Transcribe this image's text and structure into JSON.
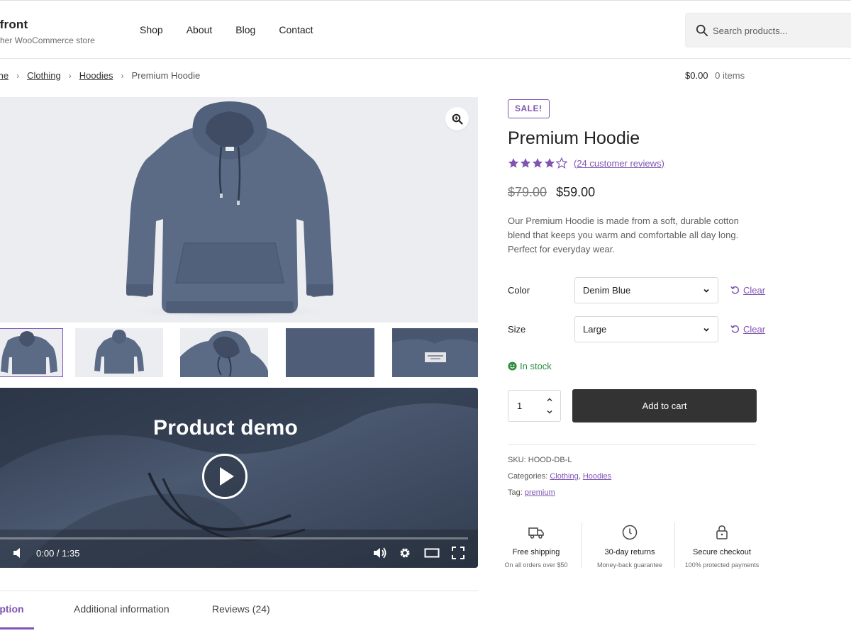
{
  "header": {
    "brand_title": "efront",
    "brand_tagline": "other WooCommerce store",
    "nav": [
      "Shop",
      "About",
      "Blog",
      "Contact"
    ],
    "search_placeholder": "Search products..."
  },
  "breadcrumb": {
    "items": [
      "me",
      "Clothing",
      "Hoodies"
    ],
    "current": "Premium Hoodie"
  },
  "cart": {
    "total": "$0.00",
    "count": "0 items"
  },
  "video": {
    "title": "Product demo",
    "time": "0:00 / 1:35",
    "progress": 0
  },
  "tabs": [
    "ription",
    "Additional information",
    "Reviews (24)"
  ],
  "product": {
    "badge": "SALE!",
    "title": "Premium Hoodie",
    "rating": 4,
    "rating_max": 5,
    "reviews_link": "(24 customer reviews)",
    "price_old": "$79.00",
    "price_new": "$59.00",
    "description": "Our Premium Hoodie is made from a soft, durable cotton blend that keeps you warm and comfortable all day long. Perfect for everyday wear.",
    "color_label": "Color",
    "color_value": "Denim Blue",
    "size_label": "Size",
    "size_value": "Large",
    "clear_label": "Clear",
    "stock": "In stock",
    "quantity": "1",
    "add_to_cart": "Add to cart",
    "sku_label": "SKU:",
    "sku": "HOOD-DB-L",
    "categories_label": "Categories:",
    "categories": [
      "Clothing",
      "Hoodies"
    ],
    "tag_label": "Tag:",
    "tag": "premium"
  },
  "features": [
    {
      "icon": "truck-icon",
      "title": "Free shipping",
      "subtitle": "On all orders over $50"
    },
    {
      "icon": "clock-icon",
      "title": "30-day returns",
      "subtitle": "Money-back guarantee"
    },
    {
      "icon": "lock-icon",
      "title": "Secure checkout",
      "subtitle": "100% protected payments"
    }
  ],
  "colors": {
    "accent": "#7f54b3",
    "button": "#333333",
    "stock": "#2c8d3f",
    "hoodie": "#5b6b86"
  }
}
